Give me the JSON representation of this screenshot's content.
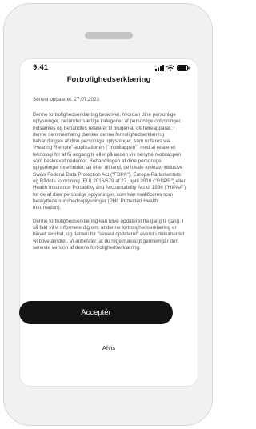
{
  "status_bar": {
    "time": "9:41",
    "icons": [
      "signal-icon",
      "wifi-icon",
      "battery-icon"
    ]
  },
  "header": {
    "title": "Fortrolighedserklæring"
  },
  "meta": {
    "updated": "Senest opdateret: 27.07.2023"
  },
  "body": {
    "paragraphs": [
      "Denne fortrolighedserklæring beskriver, hvordan dine personlige oplysninger, herunder særlige kategorier af personlige oplysninger, indsamles og behandles relateret til brugen af dit høreapparat. I denne sammenhæng dækker denne fortrolighedserklæring behandlingen af dine personlige oplysninger, som udføres via \"Hearing Remote\"-applikationen (\"mobilappen\") med al relateret teknologi for at få adgang til eller på anden vis benytte mobilappen som beskrevet nedenfor. Behandlingen af dine personlige oplysninger overholder, alt efter dit land, de lokale lovkrav, inklusive Swiss Federal Data Protection Act (\"FDPA\"), Europa-Parlamentets og Rådets forordning (EU) 2016/679 af 27. april 2016 (\"GDPR\") eller Health Insurance Portability and Accountability Act of 1996 (\"HIPAA\") for de af dine personlige oplysninger, som kan kvalificeres som beskyttede sundhedsoplysninger (PHI: Protected Health Information).",
      "Denne fortrolighedserklæring kan blive opdateret fra gang til gang. I så fald vil vi informere dig om, at denne fortrolighedserklæring er blevet ændret, og datoen for \"senest opdateret\" øverst i dokumentet vil blive ændret. Vi anbefaler, at du regelmæssigt gennemgår den seneste version af denne fortrolighedserklæring."
    ]
  },
  "actions": {
    "accept_label": "Acceptér",
    "decline_label": "Afvis"
  },
  "colors": {
    "button_bg": "#141414",
    "device_bg": "#f1f1f1",
    "body_text": "#555555"
  }
}
